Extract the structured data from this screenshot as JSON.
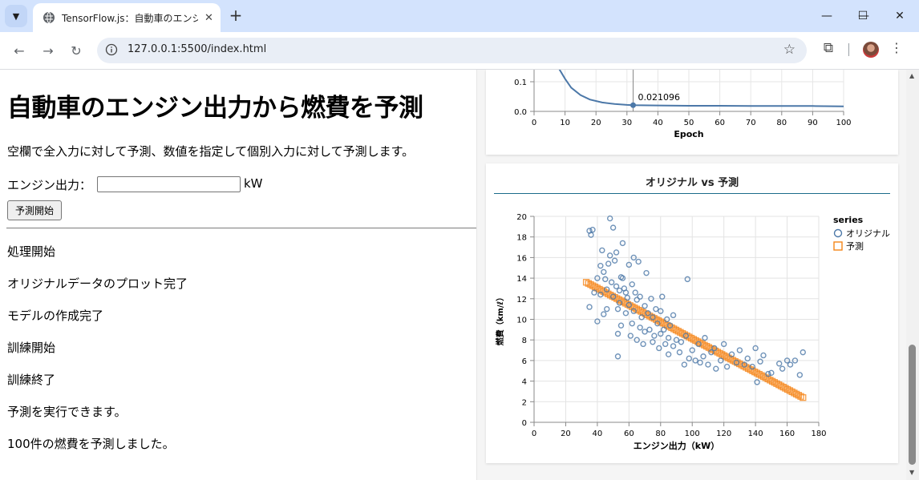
{
  "browser": {
    "tab_title": "TensorFlow.js：自動車のエンジン",
    "url": "127.0.0.1:5500/index.html"
  },
  "page": {
    "heading": "自動車のエンジン出力から燃費を予測",
    "description": "空欄で全入力に対して予測、数値を指定して個別入力に対して予測します。",
    "engine_label": "エンジン出力：",
    "engine_value": "",
    "unit": "kW",
    "predict_button": "予測開始",
    "log": [
      "処理開始",
      "オリジナルデータのプロット完了",
      "モデルの作成完了",
      "訓練開始",
      "訓練終了",
      "予測を実行できます。",
      "100件の燃費を予測しました。"
    ]
  },
  "loss_chart": {
    "type": "line",
    "xlabel": "Epoch",
    "x_ticks": [
      0,
      10,
      20,
      30,
      40,
      50,
      60,
      70,
      80,
      90,
      100
    ],
    "y_ticks": [
      "0.0",
      "0.1"
    ],
    "xlim": [
      0,
      100
    ],
    "tooltip_x": 32,
    "tooltip_value": "0.021096",
    "line_color": "#4c78a8",
    "points": [
      [
        8,
        0.145
      ],
      [
        10,
        0.11
      ],
      [
        12,
        0.08
      ],
      [
        15,
        0.055
      ],
      [
        18,
        0.04
      ],
      [
        22,
        0.03
      ],
      [
        26,
        0.025
      ],
      [
        30,
        0.022
      ],
      [
        32,
        0.021
      ],
      [
        40,
        0.02
      ],
      [
        50,
        0.019
      ],
      [
        60,
        0.019
      ],
      [
        70,
        0.018
      ],
      [
        80,
        0.018
      ],
      [
        90,
        0.018
      ],
      [
        100,
        0.017
      ]
    ]
  },
  "scatter_card": {
    "title": "オリジナル vs 予測"
  },
  "chart_data": {
    "type": "scatter",
    "xlabel": "エンジン出力（kW）",
    "ylabel": "燃費（km/ℓ）",
    "xlim": [
      0,
      180
    ],
    "ylim": [
      0,
      20
    ],
    "x_ticks": [
      0,
      20,
      40,
      60,
      80,
      100,
      120,
      140,
      160,
      180
    ],
    "y_ticks": [
      0,
      2,
      4,
      6,
      8,
      10,
      12,
      14,
      16,
      18,
      20
    ],
    "legend_title": "series",
    "legend_position": "right",
    "series": [
      {
        "name": "オリジナル",
        "color": "#4c78a8",
        "marker": "circle",
        "points": [
          [
            35,
            18.6
          ],
          [
            36,
            18.2
          ],
          [
            37,
            18.7
          ],
          [
            35,
            11.2
          ],
          [
            38,
            12.6
          ],
          [
            40,
            14.0
          ],
          [
            40,
            9.8
          ],
          [
            42,
            15.2
          ],
          [
            43,
            16.7
          ],
          [
            44,
            14.6
          ],
          [
            45,
            13.9
          ],
          [
            46,
            12.9
          ],
          [
            47,
            15.4
          ],
          [
            48,
            16.2
          ],
          [
            48,
            19.8
          ],
          [
            49,
            13.6
          ],
          [
            50,
            12.2
          ],
          [
            50,
            18.9
          ],
          [
            51,
            15.7
          ],
          [
            52,
            16.5
          ],
          [
            52,
            13.2
          ],
          [
            53,
            11.0
          ],
          [
            54,
            12.8
          ],
          [
            55,
            14.1
          ],
          [
            55,
            9.4
          ],
          [
            56,
            17.4
          ],
          [
            57,
            13.0
          ],
          [
            58,
            10.6
          ],
          [
            59,
            12.1
          ],
          [
            60,
            15.3
          ],
          [
            60,
            11.4
          ],
          [
            61,
            8.4
          ],
          [
            62,
            9.6
          ],
          [
            62,
            13.4
          ],
          [
            63,
            16.0
          ],
          [
            63,
            10.8
          ],
          [
            64,
            12.6
          ],
          [
            65,
            8.0
          ],
          [
            65,
            11.9
          ],
          [
            66,
            15.6
          ],
          [
            67,
            9.2
          ],
          [
            67,
            12.2
          ],
          [
            68,
            10.2
          ],
          [
            69,
            7.6
          ],
          [
            70,
            11.3
          ],
          [
            70,
            8.8
          ],
          [
            71,
            14.5
          ],
          [
            72,
            10.6
          ],
          [
            73,
            9.0
          ],
          [
            74,
            12.0
          ],
          [
            75,
            7.8
          ],
          [
            75,
            10.2
          ],
          [
            76,
            8.4
          ],
          [
            77,
            11.0
          ],
          [
            78,
            9.6
          ],
          [
            79,
            7.2
          ],
          [
            80,
            10.8
          ],
          [
            80,
            8.6
          ],
          [
            81,
            12.2
          ],
          [
            82,
            9.0
          ],
          [
            83,
            7.6
          ],
          [
            84,
            10.0
          ],
          [
            85,
            8.2
          ],
          [
            85,
            6.6
          ],
          [
            86,
            9.4
          ],
          [
            88,
            7.4
          ],
          [
            88,
            10.4
          ],
          [
            90,
            8.0
          ],
          [
            92,
            6.8
          ],
          [
            93,
            7.8
          ],
          [
            95,
            5.6
          ],
          [
            96,
            8.4
          ],
          [
            97,
            13.9
          ],
          [
            98,
            6.2
          ],
          [
            100,
            7.0
          ],
          [
            102,
            6.0
          ],
          [
            104,
            7.6
          ],
          [
            105,
            5.8
          ],
          [
            107,
            6.4
          ],
          [
            108,
            8.2
          ],
          [
            110,
            5.6
          ],
          [
            112,
            6.8
          ],
          [
            114,
            7.2
          ],
          [
            115,
            5.2
          ],
          [
            118,
            6.0
          ],
          [
            120,
            7.6
          ],
          [
            122,
            5.4
          ],
          [
            125,
            6.6
          ],
          [
            128,
            5.8
          ],
          [
            130,
            7.0
          ],
          [
            133,
            5.6
          ],
          [
            135,
            6.2
          ],
          [
            138,
            5.4
          ],
          [
            140,
            7.2
          ],
          [
            141,
            3.9
          ],
          [
            143,
            5.9
          ],
          [
            145,
            6.5
          ],
          [
            148,
            4.7
          ],
          [
            150,
            4.8
          ],
          [
            155,
            5.7
          ],
          [
            157,
            5.2
          ],
          [
            160,
            6.0
          ],
          [
            162,
            5.6
          ],
          [
            165,
            6.0
          ],
          [
            168,
            4.6
          ],
          [
            170,
            6.8
          ],
          [
            53,
            6.4
          ],
          [
            53,
            8.6
          ],
          [
            54,
            11.6
          ],
          [
            56,
            14.0
          ],
          [
            58,
            12.6
          ],
          [
            46,
            11.0
          ],
          [
            44,
            10.5
          ],
          [
            42,
            12.4
          ]
        ]
      },
      {
        "name": "予測",
        "color": "#f58518",
        "marker": "square",
        "line": [
          [
            33,
            13.6
          ],
          [
            170,
            2.4
          ]
        ]
      }
    ]
  }
}
